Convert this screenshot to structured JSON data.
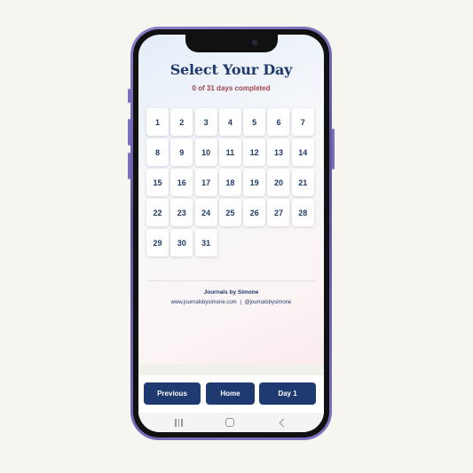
{
  "header": {
    "title": "Select Your Day",
    "progress_text": "0 of 31 days completed"
  },
  "days": [
    "1",
    "2",
    "3",
    "4",
    "5",
    "6",
    "7",
    "8",
    "9",
    "10",
    "11",
    "12",
    "13",
    "14",
    "15",
    "16",
    "17",
    "18",
    "19",
    "20",
    "21",
    "22",
    "23",
    "24",
    "25",
    "26",
    "27",
    "28",
    "29",
    "30",
    "31"
  ],
  "footer": {
    "brand": "Journals by Simone",
    "website": "www.journalsbysimone.com",
    "separator": "|",
    "handle": "@journalsbysimone"
  },
  "nav": {
    "previous_label": "Previous",
    "home_label": "Home",
    "day_label": "Day 1"
  },
  "system_nav": {
    "icons": [
      "recent-apps-icon",
      "home-icon",
      "back-icon"
    ]
  },
  "colors": {
    "primary": "#1e3a70",
    "accent": "#a0434e",
    "phone_frame": "#6b62b0"
  }
}
